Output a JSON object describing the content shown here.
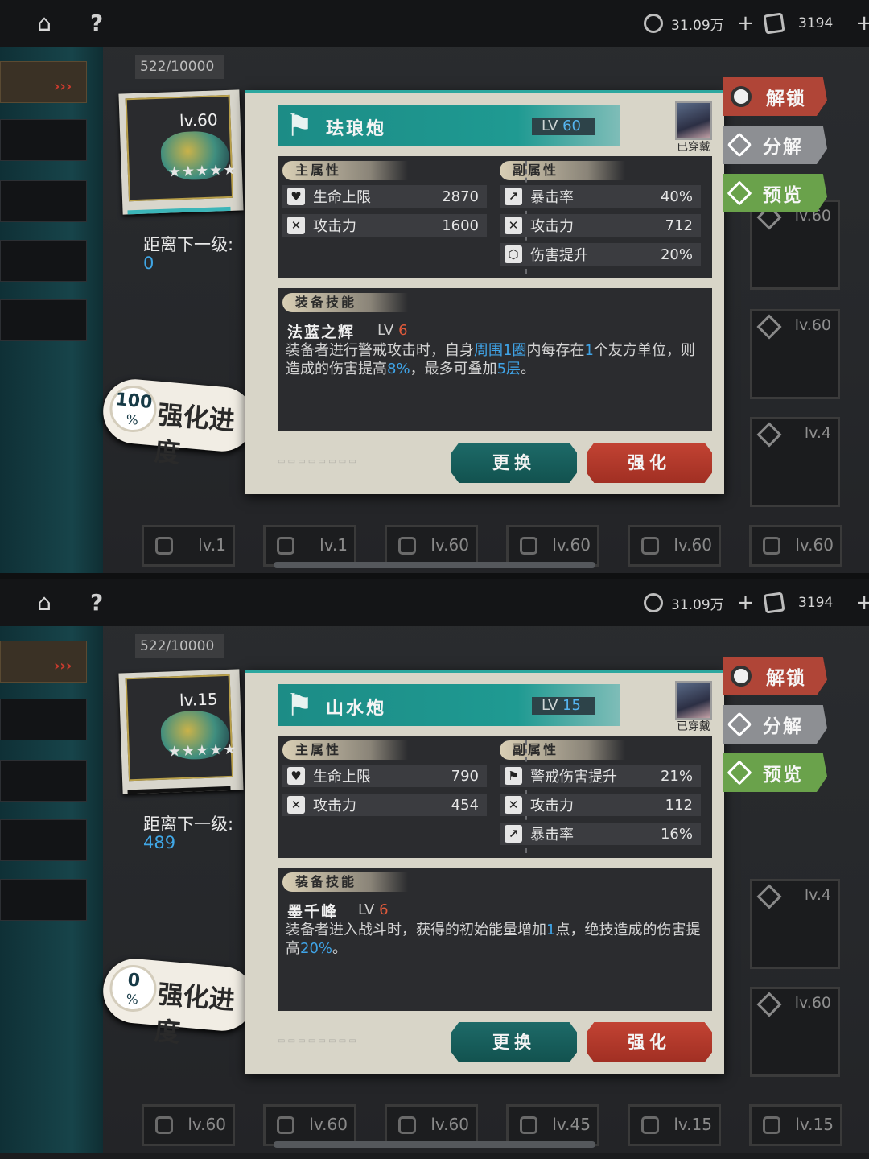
{
  "topbar": {
    "currency1": "31.09万",
    "currency2": "3194"
  },
  "capacity": "522/10000",
  "actions": {
    "unlock": "解锁",
    "decompose": "分解",
    "preview": "预览"
  },
  "labels": {
    "main_attr": "主属性",
    "sub_attr": "副属性",
    "skill_title": "装备技能",
    "next_level": "距离下一级:",
    "worn": "已穿戴",
    "lv_prefix": "LV",
    "enhance_progress": "强化进度",
    "change": "更换",
    "enhance": "强化",
    "percent": "%"
  },
  "screens": [
    {
      "card_level": "lv.60",
      "distance": "0",
      "progress": "100",
      "name": "珐琅炮",
      "level": "60",
      "main_stats": [
        {
          "icon": "heart-icon",
          "name": "生命上限",
          "value": "2870"
        },
        {
          "icon": "swords-icon",
          "name": "攻击力",
          "value": "1600"
        }
      ],
      "sub_stats": [
        {
          "icon": "crit-icon",
          "name": "暴击率",
          "value": "40%"
        },
        {
          "icon": "swords-icon",
          "name": "攻击力",
          "value": "712"
        },
        {
          "icon": "damage-boost-icon",
          "name": "伤害提升",
          "value": "20%"
        }
      ],
      "skill": {
        "name": "法蓝之辉",
        "level": "6",
        "desc": [
          "装备者进行警戒攻击时，自身",
          "周围1圈",
          "内每存在",
          "1",
          "个友方单位，则造成的伤害提高",
          "8%",
          "，最多可叠加",
          "5层",
          "。"
        ]
      },
      "grid_right": [
        "lv.60",
        "lv.60",
        "lv.4"
      ],
      "grid_bottom": [
        "lv.1",
        "lv.1",
        "lv.60",
        "lv.60",
        "lv.60",
        "lv.60"
      ]
    },
    {
      "card_level": "lv.15",
      "distance": "489",
      "progress": "0",
      "name": "山水炮",
      "level": "15",
      "main_stats": [
        {
          "icon": "heart-icon",
          "name": "生命上限",
          "value": "790"
        },
        {
          "icon": "swords-icon",
          "name": "攻击力",
          "value": "454"
        }
      ],
      "sub_stats": [
        {
          "icon": "flag-icon",
          "name": "警戒伤害提升",
          "value": "21%"
        },
        {
          "icon": "swords-icon",
          "name": "攻击力",
          "value": "112"
        },
        {
          "icon": "crit-icon",
          "name": "暴击率",
          "value": "16%"
        }
      ],
      "skill": {
        "name": "墨千峰",
        "level": "6",
        "desc": [
          "装备者进入战斗时，获得的初始能量增加",
          "1",
          "点，绝技造成的伤害提高",
          "20%",
          "。"
        ]
      },
      "grid_right": [
        "lv.4",
        "lv.60"
      ],
      "grid_bottom": [
        "lv.60",
        "lv.60",
        "lv.60",
        "lv.45",
        "lv.15",
        "lv.15"
      ]
    }
  ]
}
